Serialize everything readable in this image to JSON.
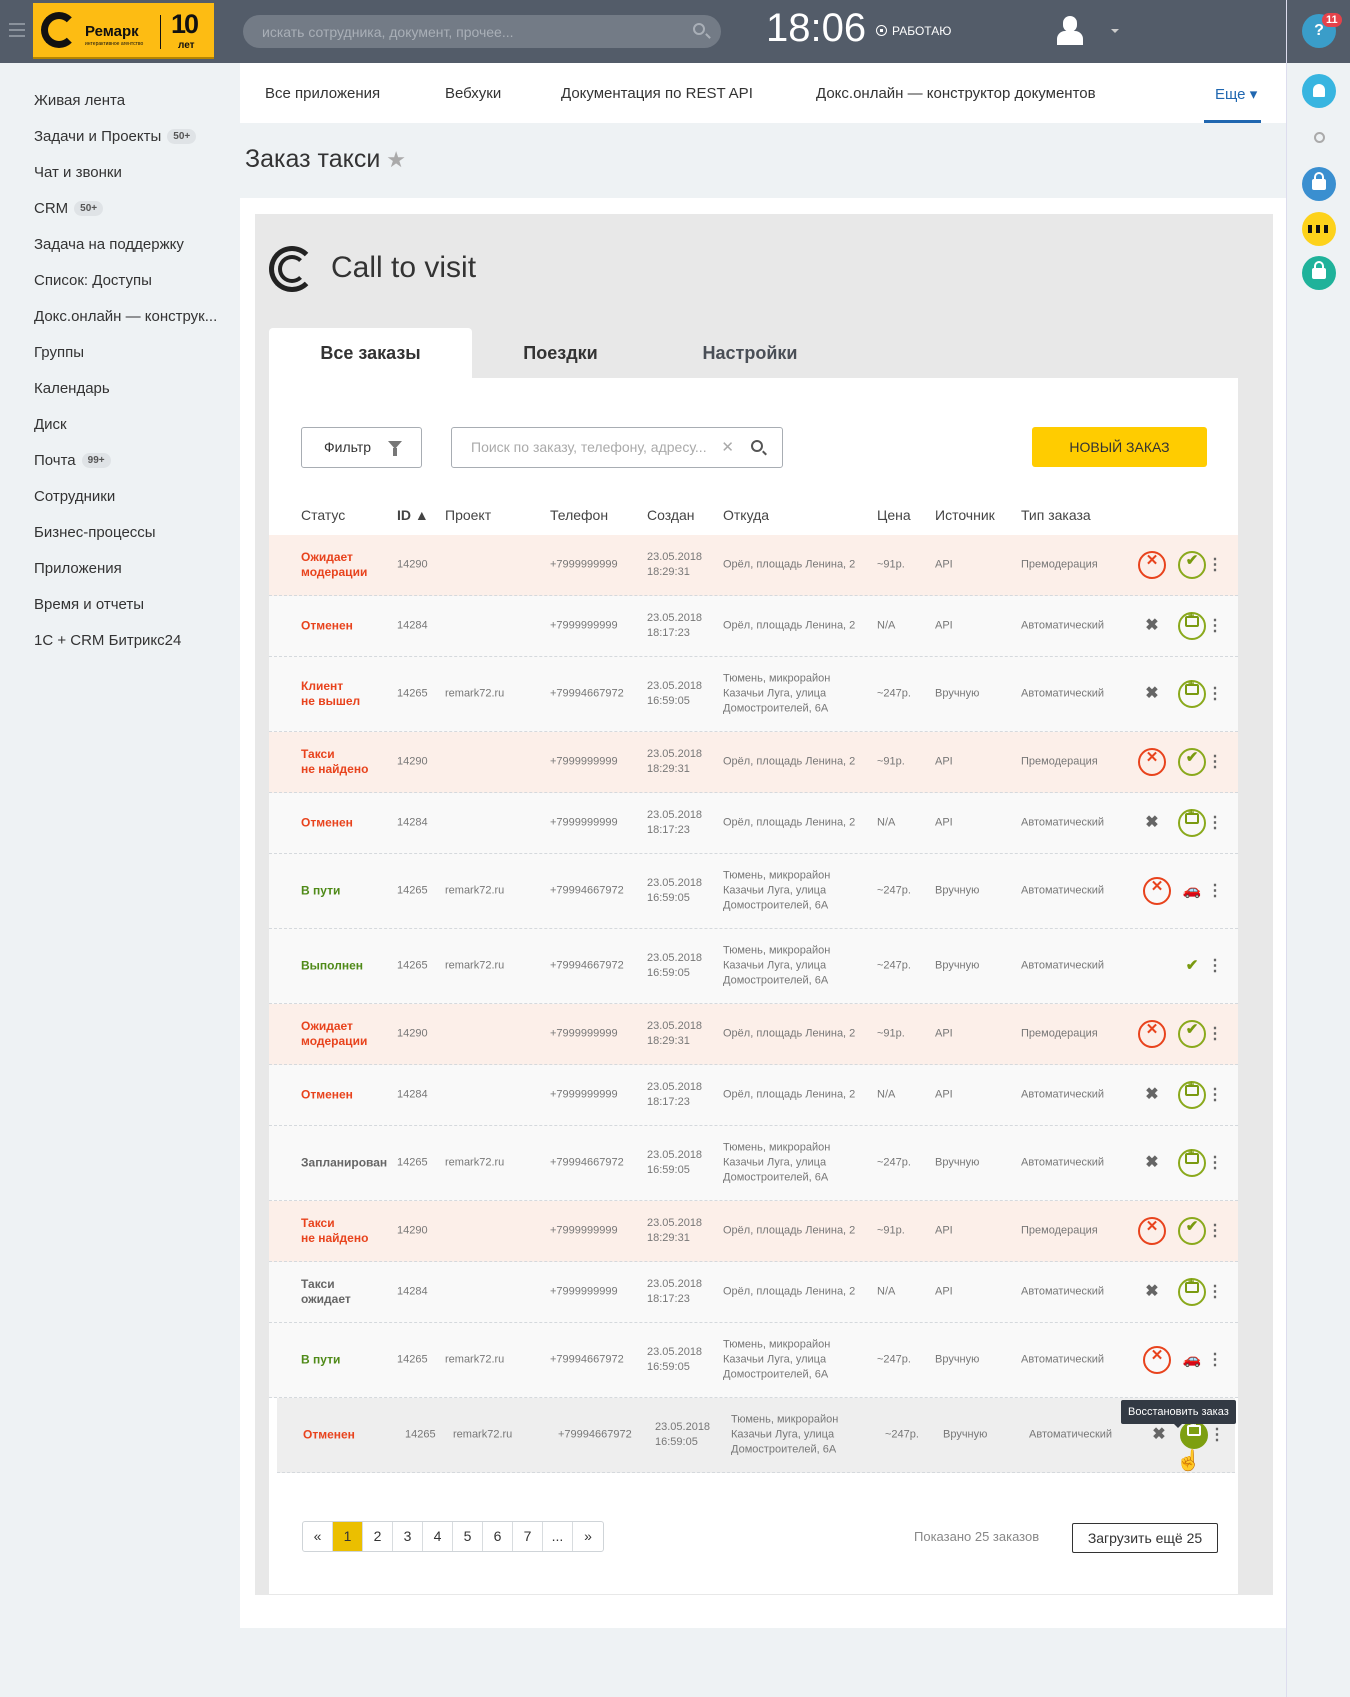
{
  "header": {
    "logo_name": "Ремарк",
    "logo_sub": "интерактивное агентство",
    "logo_years": "10",
    "logo_years_label": "лет",
    "search_placeholder": "искать сотрудника, документ, прочее...",
    "clock": "18:06",
    "work_status": "РАБОТАЮ"
  },
  "right_panel": {
    "help_label": "?",
    "help_badge": "11"
  },
  "sidebar": {
    "items": [
      {
        "label": "Живая лента"
      },
      {
        "label": "Задачи и Проекты",
        "badge": "50+"
      },
      {
        "label": "Чат и звонки"
      },
      {
        "label": "CRM",
        "badge": "50+"
      },
      {
        "label": "Задача на поддержку"
      },
      {
        "label": "Список: Доступы"
      },
      {
        "label": "Докс.онлайн — конструк..."
      },
      {
        "label": "Группы"
      },
      {
        "label": "Календарь"
      },
      {
        "label": "Диск"
      },
      {
        "label": "Почта",
        "badge": "99+"
      },
      {
        "label": "Сотрудники"
      },
      {
        "label": "Бизнес-процессы"
      },
      {
        "label": "Приложения"
      },
      {
        "label": "Время и отчеты"
      },
      {
        "label": "1С + CRM Битрикс24"
      }
    ]
  },
  "topnav": {
    "items": [
      "Все приложения",
      "Вебхуки",
      "Документация по REST API",
      "Докс.онлайн — конструктор документов"
    ],
    "more": "Еще"
  },
  "page": {
    "title": "Заказ такси"
  },
  "app": {
    "brand": "Call to visit",
    "tabs": [
      "Все заказы",
      "Поездки",
      "Настройки"
    ],
    "filter_label": "Фильтр",
    "search_placeholder": "Поиск по заказу, телефону, адресу...",
    "new_order": "НОВЫЙ ЗАКАЗ",
    "columns": [
      "Статус",
      "ID ▲",
      "Проект",
      "Телефон",
      "Создан",
      "Откуда",
      "Цена",
      "Источник",
      "Тип заказа"
    ],
    "rows": [
      {
        "status": "Ожидает\nмодерации",
        "status_color": "red",
        "id": "14290",
        "project": "",
        "phone": "+7999999999",
        "created": "23.05.2018\n18:29:31",
        "from": "Орёл, площадь Ленина, 2",
        "price": "~91р.",
        "source": "API",
        "type": "Премодерация",
        "bg": "pink",
        "actions": "moderation"
      },
      {
        "status": "Отменен",
        "status_color": "red",
        "id": "14284",
        "project": "",
        "phone": "+7999999999",
        "created": "23.05.2018\n18:17:23",
        "from": "Орёл, площадь Ленина, 2",
        "price": "N/A",
        "source": "API",
        "type": "Автоматический",
        "bg": "grey",
        "actions": "restore"
      },
      {
        "status": "Клиент\nне вышел",
        "status_color": "red",
        "id": "14265",
        "project": "remark72.ru",
        "phone": "+79994667972",
        "created": "23.05.2018\n16:59:05",
        "from": "Тюмень, микрорайон\nКазачьи Луга, улица\nДомостроителей, 6А",
        "price": "~247р.",
        "source": "Вручную",
        "type": "Автоматический",
        "bg": "grey",
        "actions": "restore"
      },
      {
        "status": "Такси\nне найдено",
        "status_color": "red",
        "id": "14290",
        "project": "",
        "phone": "+7999999999",
        "created": "23.05.2018\n18:29:31",
        "from": "Орёл, площадь Ленина, 2",
        "price": "~91р.",
        "source": "API",
        "type": "Премодерация",
        "bg": "pink",
        "actions": "moderation"
      },
      {
        "status": "Отменен",
        "status_color": "red",
        "id": "14284",
        "project": "",
        "phone": "+7999999999",
        "created": "23.05.2018\n18:17:23",
        "from": "Орёл, площадь Ленина, 2",
        "price": "N/A",
        "source": "API",
        "type": "Автоматический",
        "bg": "grey",
        "actions": "restore"
      },
      {
        "status": "В пути",
        "status_color": "green",
        "id": "14265",
        "project": "remark72.ru",
        "phone": "+79994667972",
        "created": "23.05.2018\n16:59:05",
        "from": "Тюмень, микрорайон\nКазачьи Луга, улица\nДомостроителей, 6А",
        "price": "~247р.",
        "source": "Вручную",
        "type": "Автоматический",
        "bg": "grey",
        "actions": "cancel-car"
      },
      {
        "status": "Выполнен",
        "status_color": "green",
        "id": "14265",
        "project": "remark72.ru",
        "phone": "+79994667972",
        "created": "23.05.2018\n16:59:05",
        "from": "Тюмень, микрорайон\nКазачьи Луга, улица\nДомостроителей, 6А",
        "price": "~247р.",
        "source": "Вручную",
        "type": "Автоматический",
        "bg": "grey",
        "actions": "done"
      },
      {
        "status": "Ожидает\nмодерации",
        "status_color": "red",
        "id": "14290",
        "project": "",
        "phone": "+7999999999",
        "created": "23.05.2018\n18:29:31",
        "from": "Орёл, площадь Ленина, 2",
        "price": "~91р.",
        "source": "API",
        "type": "Премодерация",
        "bg": "pink",
        "actions": "moderation"
      },
      {
        "status": "Отменен",
        "status_color": "red",
        "id": "14284",
        "project": "",
        "phone": "+7999999999",
        "created": "23.05.2018\n18:17:23",
        "from": "Орёл, площадь Ленина, 2",
        "price": "N/A",
        "source": "API",
        "type": "Автоматический",
        "bg": "grey",
        "actions": "restore"
      },
      {
        "status": "Запланирован",
        "status_color": "gray",
        "id": "14265",
        "project": "remark72.ru",
        "phone": "+79994667972",
        "created": "23.05.2018\n16:59:05",
        "from": "Тюмень, микрорайон\nКазачьи Луга, улица\nДомостроителей, 6А",
        "price": "~247р.",
        "source": "Вручную",
        "type": "Автоматический",
        "bg": "grey",
        "actions": "restore"
      },
      {
        "status": "Такси\nне найдено",
        "status_color": "red",
        "id": "14290",
        "project": "",
        "phone": "+7999999999",
        "created": "23.05.2018\n18:29:31",
        "from": "Орёл, площадь Ленина, 2",
        "price": "~91р.",
        "source": "API",
        "type": "Премодерация",
        "bg": "pink",
        "actions": "moderation"
      },
      {
        "status": "Такси\nожидает",
        "status_color": "gray",
        "id": "14284",
        "project": "",
        "phone": "+7999999999",
        "created": "23.05.2018\n18:17:23",
        "from": "Орёл, площадь Ленина, 2",
        "price": "N/A",
        "source": "API",
        "type": "Автоматический",
        "bg": "grey",
        "actions": "restore"
      },
      {
        "status": "В пути",
        "status_color": "green",
        "id": "14265",
        "project": "remark72.ru",
        "phone": "+79994667972",
        "created": "23.05.2018\n16:59:05",
        "from": "Тюмень, микрорайон\nКазачьи Луга, улица\nДомостроителей, 6А",
        "price": "~247р.",
        "source": "Вручную",
        "type": "Автоматический",
        "bg": "grey",
        "actions": "cancel-car"
      },
      {
        "status": "Отменен",
        "status_color": "red",
        "id": "14265",
        "project": "remark72.ru",
        "phone": "+79994667972",
        "created": "23.05.2018\n16:59:05",
        "from": "Тюмень, микрорайон\nКазачьи Луга, улица\nДомостроителей, 6А",
        "price": "~247р.",
        "source": "Вручную",
        "type": "Автоматический",
        "bg": "hover",
        "actions": "restore-hover"
      }
    ],
    "tooltip": "Восстановить заказ",
    "pagination": {
      "prev": "«",
      "pages": [
        "1",
        "2",
        "3",
        "4",
        "5",
        "6",
        "7",
        "..."
      ],
      "next": "»",
      "current": "1"
    },
    "shown_text": "Показано 25 заказов",
    "load_more": "Загрузить ещё 25"
  }
}
